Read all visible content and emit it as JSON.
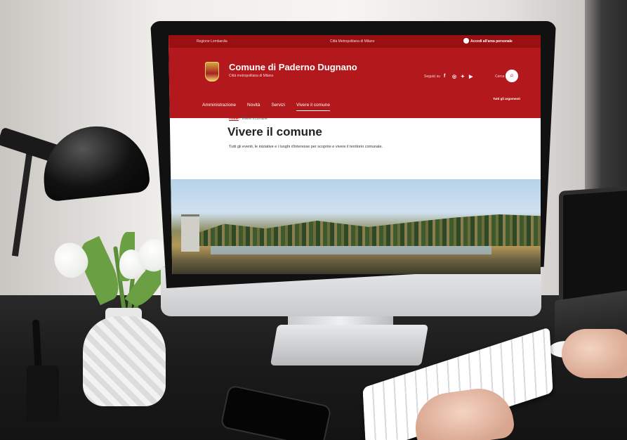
{
  "site": {
    "topbar": {
      "region": "Regione Lombardia",
      "metro_city": "Città Metropolitana di Milano",
      "access_label": "Accedi all'area personale"
    },
    "header": {
      "title": "Comune di Paderno Dugnano",
      "subtitle": "Città metropolitana di Milano",
      "follow_label": "Seguici su",
      "social": [
        "f",
        "◎",
        "✦",
        "▶"
      ],
      "search_label": "Cerca",
      "search_icon": "⌕"
    },
    "nav": {
      "items": [
        "Amministrazione",
        "Novità",
        "Servizi",
        "Vivere il comune"
      ],
      "active_index": 3,
      "all_topics": "Tutti gli argomenti"
    },
    "breadcrumb": {
      "home": "Home",
      "separator": "/",
      "current": "Vivere il comune"
    },
    "page": {
      "title": "Vivere il comune",
      "description": "Tutti gli eventi, le iniziative e i luoghi d'interesse per scoprire e vivere il territorio comunale."
    }
  },
  "colors": {
    "brand_red": "#b3191c",
    "topbar_red": "#9a0f12"
  }
}
